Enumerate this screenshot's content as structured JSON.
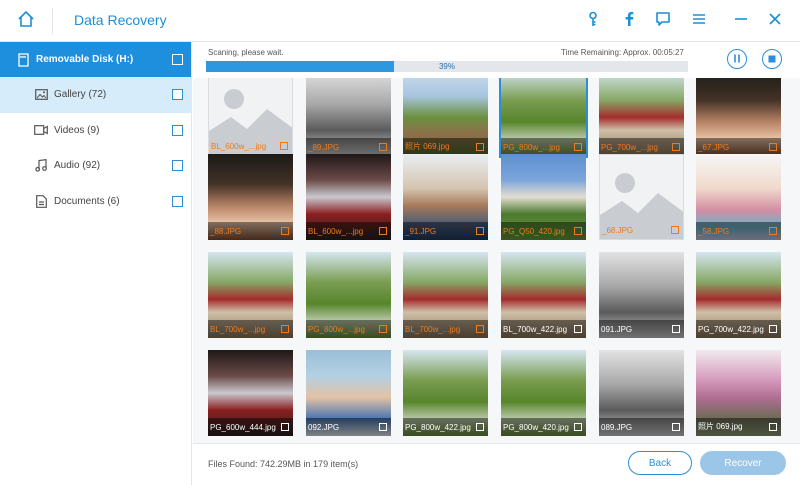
{
  "app": {
    "title": "Data Recovery"
  },
  "titlebar_icons": [
    "home-icon",
    "key-icon",
    "facebook-icon",
    "feedback-icon",
    "menu-icon",
    "minimize-icon",
    "close-icon"
  ],
  "sidebar": {
    "disk_label": "Removable Disk (H:)",
    "items": [
      {
        "label": "Gallery (72)",
        "icon": "image-icon"
      },
      {
        "label": "Videos (9)",
        "icon": "video-icon"
      },
      {
        "label": "Audio (92)",
        "icon": "music-icon"
      },
      {
        "label": "Documents (6)",
        "icon": "document-icon"
      }
    ]
  },
  "progress": {
    "status": "Scaning, please wait.",
    "time_remaining": "Time Remaining: Approx. 00:05:27",
    "percent_label": "39%",
    "value": 0.39
  },
  "grid": {
    "items": [
      {
        "name": "BL_600w_...jpg",
        "scene": "placeholder",
        "color": "orange"
      },
      {
        "name": "_89.JPG",
        "scene": "bw",
        "color": "orange"
      },
      {
        "name": "照片 069.jpg",
        "scene": "park",
        "color": "orange"
      },
      {
        "name": "PG_800w_...jpg",
        "scene": "alley",
        "color": "orange",
        "selected": true
      },
      {
        "name": "PG_700w_...jpg",
        "scene": "bridge",
        "color": "orange"
      },
      {
        "name": "_67.JPG",
        "scene": "family",
        "color": "orange"
      },
      {
        "name": "_88.JPG",
        "scene": "family",
        "color": "orange"
      },
      {
        "name": "BL_600w_...jpg",
        "scene": "moto",
        "color": "orange"
      },
      {
        "name": "_91.JPG",
        "scene": "oldman",
        "color": "orange"
      },
      {
        "name": "PG_Q50_420.jpg",
        "scene": "building",
        "color": "orange"
      },
      {
        "name": "_68.JPG",
        "scene": "placeholder",
        "color": "orange"
      },
      {
        "name": "_58.JPG",
        "scene": "girl",
        "color": "orange"
      },
      {
        "name": "BL_700w_...jpg",
        "scene": "bridge",
        "color": "orange"
      },
      {
        "name": "PG_800w_...jpg",
        "scene": "alley",
        "color": "orange"
      },
      {
        "name": "BL_700w_...jpg",
        "scene": "bridge",
        "color": "orange"
      },
      {
        "name": "BL_700w_422.jpg",
        "scene": "bridge",
        "color": "white"
      },
      {
        "name": "091.JPG",
        "scene": "bw",
        "color": "white"
      },
      {
        "name": "PG_700w_422.jpg",
        "scene": "bridge",
        "color": "white"
      },
      {
        "name": "PG_600w_444.jpg",
        "scene": "moto",
        "color": "white"
      },
      {
        "name": "092.JPG",
        "scene": "smiling",
        "color": "white"
      },
      {
        "name": "PG_800w_422.jpg",
        "scene": "alley",
        "color": "white"
      },
      {
        "name": "PG_800w_420.jpg",
        "scene": "alley",
        "color": "white"
      },
      {
        "name": "089.JPG",
        "scene": "bw",
        "color": "white"
      },
      {
        "name": "照片 069.jpg",
        "scene": "tree",
        "color": "white"
      }
    ]
  },
  "footer": {
    "files_found": "Files Found: 742.29MB in 179 item(s)",
    "back_label": "Back",
    "recover_label": "Recover"
  },
  "colors": {
    "accent": "#1d8fdd",
    "orange_text": "#f07a1a",
    "recover_disabled": "#9bc6e8"
  }
}
